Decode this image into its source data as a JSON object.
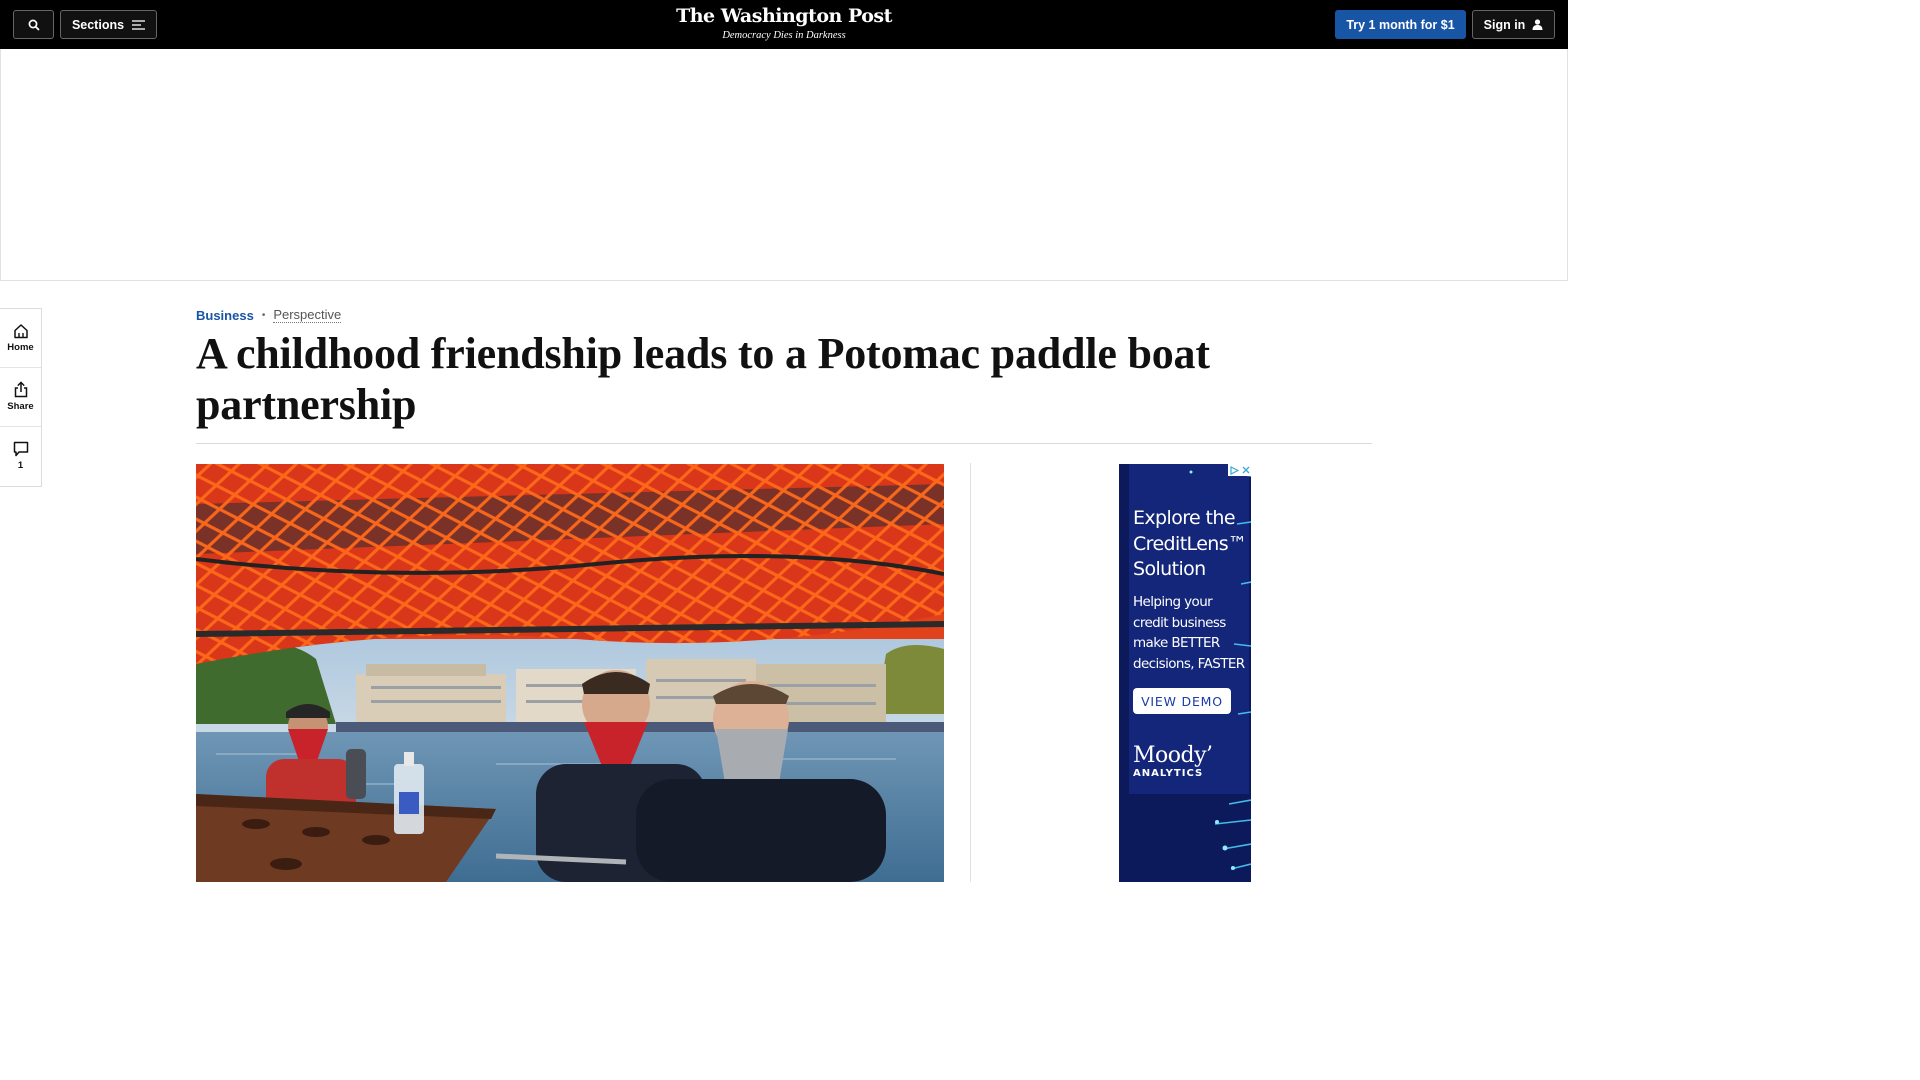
{
  "header": {
    "sections_label": "Sections",
    "logo": "The Washington Post",
    "tagline": "Democracy Dies in Darkness",
    "trial_label": "Try 1 month for $1",
    "signin_label": "Sign in"
  },
  "rail": {
    "home_label": "Home",
    "share_label": "Share",
    "comments_count": "1"
  },
  "article": {
    "section": "Business",
    "label": "Perspective",
    "headline": "A childhood friendship leads to a Potomac paddle boat partnership"
  },
  "side_ad": {
    "headline": "Explore the CreditLens™ Solution",
    "body": "Helping your credit business make BETTER decisions, FASTER",
    "cta": "VIEW DEMO"
  },
  "colors": {
    "brand_blue": "#1955a5",
    "topbar": "#000000"
  },
  "icons": [
    "search-icon",
    "menu-icon",
    "user-icon",
    "home-icon",
    "share-icon",
    "comment-icon",
    "adchoices-icon",
    "close-icon"
  ]
}
